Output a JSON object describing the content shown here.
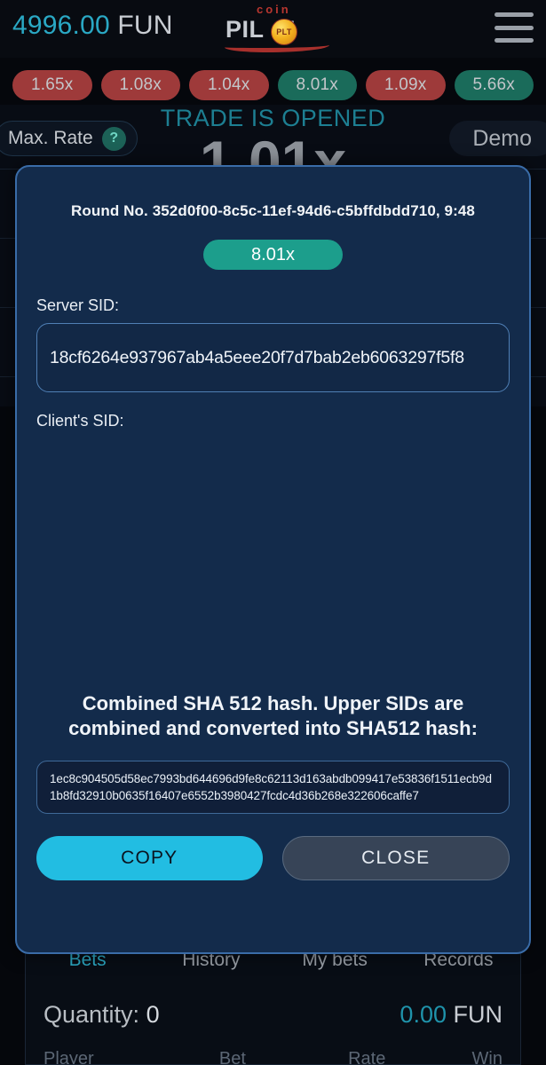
{
  "header": {
    "balance_amount": "4996.00",
    "balance_currency": "FUN",
    "logo_top_word": "coin",
    "logo_main_word": "PIL",
    "logo_main_word_tail": "T",
    "logo_coin_text": "PLT",
    "menu_icon": "hamburger-menu-icon"
  },
  "round_history": [
    {
      "value": "1.65x",
      "tone": "red"
    },
    {
      "value": "1.08x",
      "tone": "red"
    },
    {
      "value": "1.04x",
      "tone": "red"
    },
    {
      "value": "8.01x",
      "tone": "teal"
    },
    {
      "value": "1.09x",
      "tone": "red"
    },
    {
      "value": "5.66x",
      "tone": "teal"
    }
  ],
  "game": {
    "status_text": "TRADE IS OPENED",
    "current_multiplier": "1.01x",
    "max_rate_label": "Max. Rate",
    "help_icon": "question-mark-icon",
    "mode_label": "Demo"
  },
  "modal": {
    "round_line": "Round No. 352d0f00-8c5c-11ef-94d6-c5bffdbdd710, 9:48",
    "round_multiplier": "8.01x",
    "server_sid_label": "Server SID:",
    "server_sid_value": "18cf6264e937967ab4a5eee20f7d7bab2eb6063297f5f8",
    "client_sid_label": "Client's SID:",
    "client_sid_value": "",
    "sha_title": "Combined SHA 512 hash. Upper SIDs are combined and converted into SHA512 hash:",
    "sha_hash": "1ec8c904505d58ec7993bd644696d9fe8c62113d163abdb099417e53836f1511ecb9d1b8fd32910b0635f16407e6552b3980427fcdc4d36b268e322606caffe7",
    "copy_label": "COPY",
    "close_label": "CLOSE"
  },
  "bottom": {
    "tabs": [
      {
        "label": "Bets",
        "active": true
      },
      {
        "label": "History",
        "active": false
      },
      {
        "label": "My bets",
        "active": false
      },
      {
        "label": "Records",
        "active": false
      }
    ],
    "quantity_label": "Quantity:",
    "quantity_value": "0",
    "total_amount": "0.00",
    "total_currency": "FUN",
    "columns": [
      "Player",
      "Bet",
      "Rate",
      "Win"
    ]
  },
  "colors": {
    "accent_cyan": "#22bde2",
    "accent_teal": "#1c9e8c",
    "badge_red": "#9e3a3a",
    "badge_teal": "#1a6b5a",
    "modal_bg": "#132b4b",
    "modal_border": "#3a6ca8"
  }
}
